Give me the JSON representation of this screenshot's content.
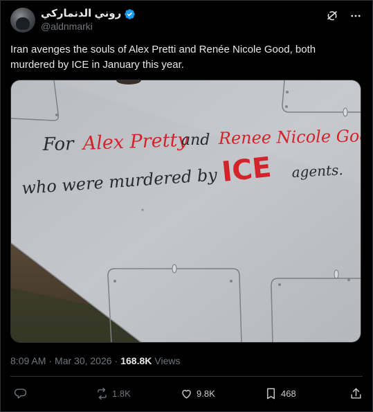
{
  "author": {
    "display_name": "روني الدنماركي",
    "handle": "@aldnmarki",
    "verified": true
  },
  "header_icons": [
    "grok-icon",
    "more-icon"
  ],
  "tweet": {
    "text": "Iran avenges the souls of Alex Pretti and Renée Nicole Good, both murdered by ICE in January this year."
  },
  "media": {
    "line1_black_1": "For",
    "line1_red_1": "Alex Pretty",
    "line1_black_2": "and",
    "line1_red_2": "Renee Nicole Good,",
    "line2_black_1": "who were murdered by",
    "line2_red_1": "ICE",
    "line2_black_2": "agents."
  },
  "meta": {
    "time": "8:09 AM",
    "separator": "·",
    "date": "Mar 30, 2026",
    "views_count": "168.8K",
    "views_label": "Views"
  },
  "actions": {
    "reply_count": "",
    "repost_count": "1.8K",
    "like_count": "9.8K",
    "bookmark_count": "468"
  },
  "colors": {
    "background": "#000000",
    "text": "#e7e9ea",
    "muted": "#71767b",
    "border": "#2f3336",
    "verified": "#1d9bf0",
    "marker_red": "#d3242c"
  }
}
